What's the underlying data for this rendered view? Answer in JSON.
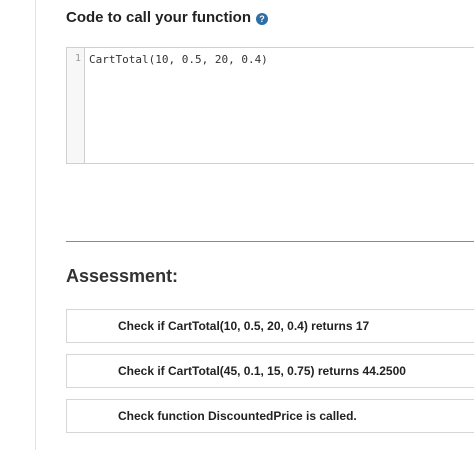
{
  "code_section": {
    "title": "Code to call your function",
    "help_icon_glyph": "?",
    "help_icon": "question-circle-icon",
    "editor": {
      "line_number": "1",
      "code": "CartTotal(10, 0.5, 20, 0.4)"
    }
  },
  "assessment": {
    "title": "Assessment:",
    "checks": [
      {
        "text": "Check if CartTotal(10, 0.5, 20, 0.4) returns 17"
      },
      {
        "text": "Check if CartTotal(45, 0.1, 15, 0.75) returns 44.2500"
      },
      {
        "text": "Check function DiscountedPrice is called."
      }
    ]
  },
  "colors": {
    "help_icon_background": "#2f6ea5",
    "divider": "#8a8a8a"
  }
}
